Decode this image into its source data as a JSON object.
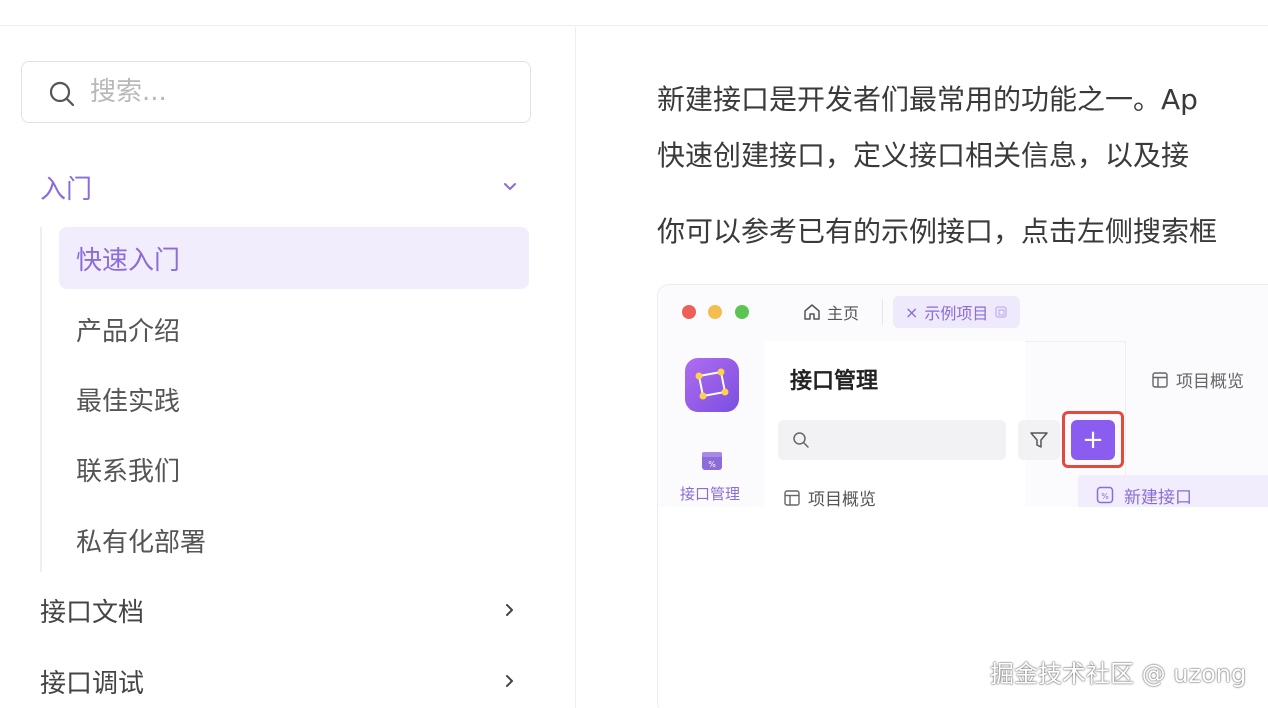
{
  "search": {
    "placeholder": "搜索..."
  },
  "sidebar": {
    "sections": [
      {
        "label": "入门",
        "expanded": true
      },
      {
        "label": "接口文档",
        "expanded": false
      },
      {
        "label": "接口调试",
        "expanded": false
      }
    ],
    "subitems": [
      "快速入门",
      "产品介绍",
      "最佳实践",
      "联系我们",
      "私有化部署"
    ],
    "active_subitem": "快速入门"
  },
  "content": {
    "lines": [
      "新建接口是开发者们最常用的功能之一。Ap",
      "快速创建接口，定义接口相关信息，以及接",
      "你可以参考已有的示例接口，点击左侧搜索框"
    ]
  },
  "screenshot": {
    "tab_home": "主页",
    "tab_project": "示例项目",
    "side_nav_label": "接口管理",
    "panel_title": "接口管理",
    "overview_tab": "项目概览",
    "tree_item": "项目概览",
    "new_api": "新建接口",
    "add_symbol": "+"
  },
  "watermark": "掘金技术社区 @ uzong",
  "colors": {
    "accent": "#8b6cd8",
    "highlight_border": "#e24a3f",
    "active_bg": "#f2edfd"
  }
}
